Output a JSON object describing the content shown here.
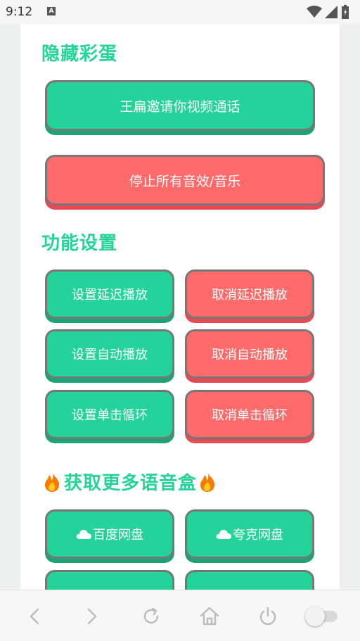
{
  "status_bar": {
    "time": "9:12",
    "notification_letter": "A"
  },
  "sections": {
    "hidden_eggs": {
      "title": "隐藏彩蛋",
      "video_call_label": "王扁邀请你视频通话",
      "stop_all_label": "停止所有音效/音乐"
    },
    "settings": {
      "title": "功能设置",
      "set_delay_label": "设置延迟播放",
      "cancel_delay_label": "取消延迟播放",
      "set_auto_label": "设置自动播放",
      "cancel_auto_label": "取消自动播放",
      "set_loop_label": "设置单击循环",
      "cancel_loop_label": "取消单击循环"
    },
    "more_boxes": {
      "title": "获取更多语音盒",
      "baidu_label": "百度网盘",
      "quark_label": "夸克网盘"
    }
  },
  "colors": {
    "accent_green": "#24d39a",
    "accent_red": "#ff6b6b"
  }
}
